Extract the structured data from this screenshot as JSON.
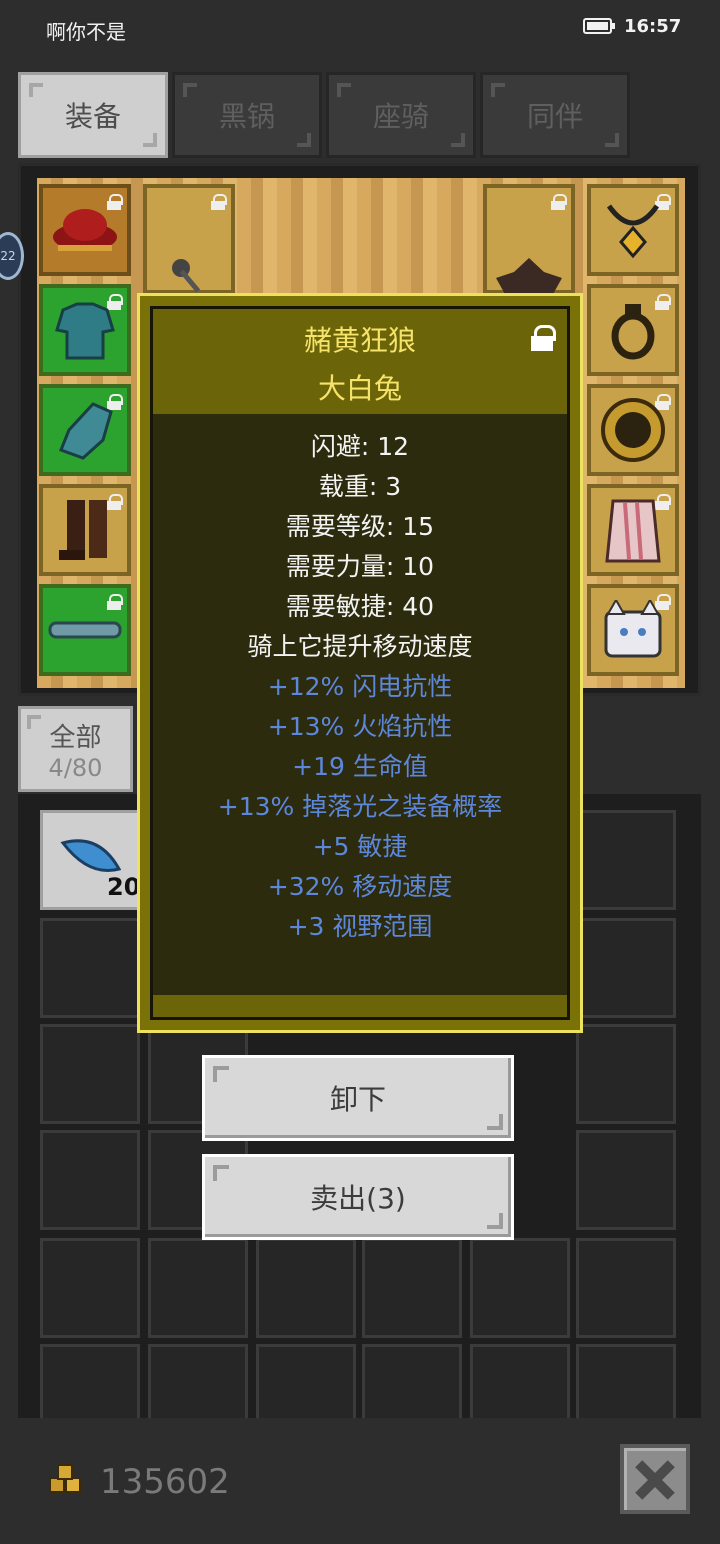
{
  "status_bar": {
    "title": "啊你不是",
    "time": "16:57"
  },
  "tabs": [
    {
      "label": "装备",
      "active": true
    },
    {
      "label": "黑锅",
      "active": false
    },
    {
      "label": "座骑",
      "active": false
    },
    {
      "label": "同伴",
      "active": false
    }
  ],
  "side_badge": "22",
  "inventory": {
    "filter_label": "全部",
    "capacity": "4/80",
    "first_item_count": "20"
  },
  "tooltip": {
    "item_name": "赭黄狂狼",
    "item_subname": "大白兔",
    "base_stats": [
      "闪避: 12",
      "载重: 3",
      "需要等级: 15",
      "需要力量: 10",
      "需要敏捷: 40",
      "骑上它提升移动速度"
    ],
    "bonus_stats": [
      "+12% 闪电抗性",
      "+13% 火焰抗性",
      "+19 生命值",
      "+13% 掉落光之装备概率",
      "+5 敏捷",
      "+32% 移动速度",
      "+3 视野范围"
    ]
  },
  "actions": {
    "unequip": "卸下",
    "sell": "卖出(3)"
  },
  "footer": {
    "gold": "135602"
  },
  "colors": {
    "tooltip_title": "#f6e46a",
    "tooltip_bonus": "#5d87db",
    "tooltip_border": "#ece25e"
  }
}
